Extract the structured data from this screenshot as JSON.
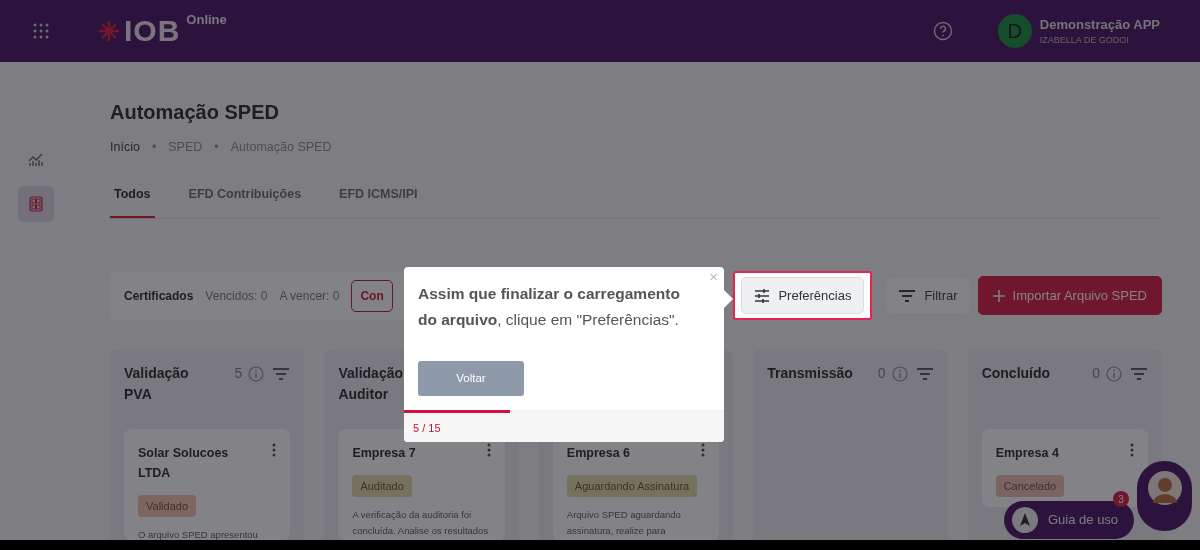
{
  "header": {
    "logo": "IOB",
    "logo_suffix": "Online",
    "user_initial": "D",
    "user_name": "Demonstração APP",
    "user_subtitle": "IZABELLA DE GODOI"
  },
  "sidebar": {
    "items": [
      {
        "kind": "chart",
        "selected": false
      },
      {
        "kind": "grid",
        "selected": true
      }
    ]
  },
  "page": {
    "title": "Automação SPED",
    "breadcrumb": [
      {
        "kind": "link",
        "text": "Início"
      },
      {
        "kind": "separator",
        "text": "•"
      },
      {
        "kind": "link",
        "text": "SPED"
      },
      {
        "kind": "separator",
        "text": "•"
      },
      {
        "kind": "current",
        "text": "Automação SPED"
      }
    ]
  },
  "tabs": [
    {
      "label": "Todos",
      "selected": true
    },
    {
      "label": "EFD Contribuições",
      "selected": false
    },
    {
      "label": "EFD ICMS/IPI",
      "selected": false
    }
  ],
  "certificates": {
    "label": "Certificados",
    "expired": "Vencidos: 0",
    "expiring": "A vencer: 0",
    "button": "Con"
  },
  "actions": [
    {
      "kind": "preferences",
      "label": "Preferências",
      "highlighted": true
    },
    {
      "kind": "filter",
      "label": "Filtrar",
      "highlighted": false
    },
    {
      "kind": "import",
      "label": "Importar Arquivo SPED",
      "highlighted": false
    }
  ],
  "columns": [
    {
      "title": "Validação PVA",
      "count": "5",
      "cards": [
        {
          "name": "Solar Solucoes LTDA",
          "status": "Validado",
          "color": "#7d6560",
          "text": "O arquivo SPED apresentou"
        }
      ]
    },
    {
      "title": "Validação Auditor",
      "cards": [
        {
          "name": "Empresa 7",
          "status": "Auditado",
          "color": "#76705f",
          "text": "A verificação da auditoria foi concluída. Analise os resultados"
        }
      ]
    },
    {
      "cards": [
        {
          "name": "Empresa 6",
          "status": "Aguardando Assinatura",
          "color": "#76705f",
          "text": "Arquivo SPED aguardando assinatura, realize para"
        }
      ]
    },
    {
      "title": "Transmissão",
      "count": "0"
    },
    {
      "title": "Concluído",
      "count": "0",
      "cards": [
        {
          "name": "Empresa 4",
          "status": "Cancelado",
          "color": "#7a6462"
        }
      ]
    }
  ],
  "tour": {
    "close": "×",
    "text": "**Assim que finalizar o carregamento do arquivo**, clique em \"Preferências\".",
    "back_button": "Voltar",
    "level": 0.33,
    "progress": "5 / 15"
  },
  "guide": {
    "label": "Guia de uso",
    "badge": "3"
  }
}
